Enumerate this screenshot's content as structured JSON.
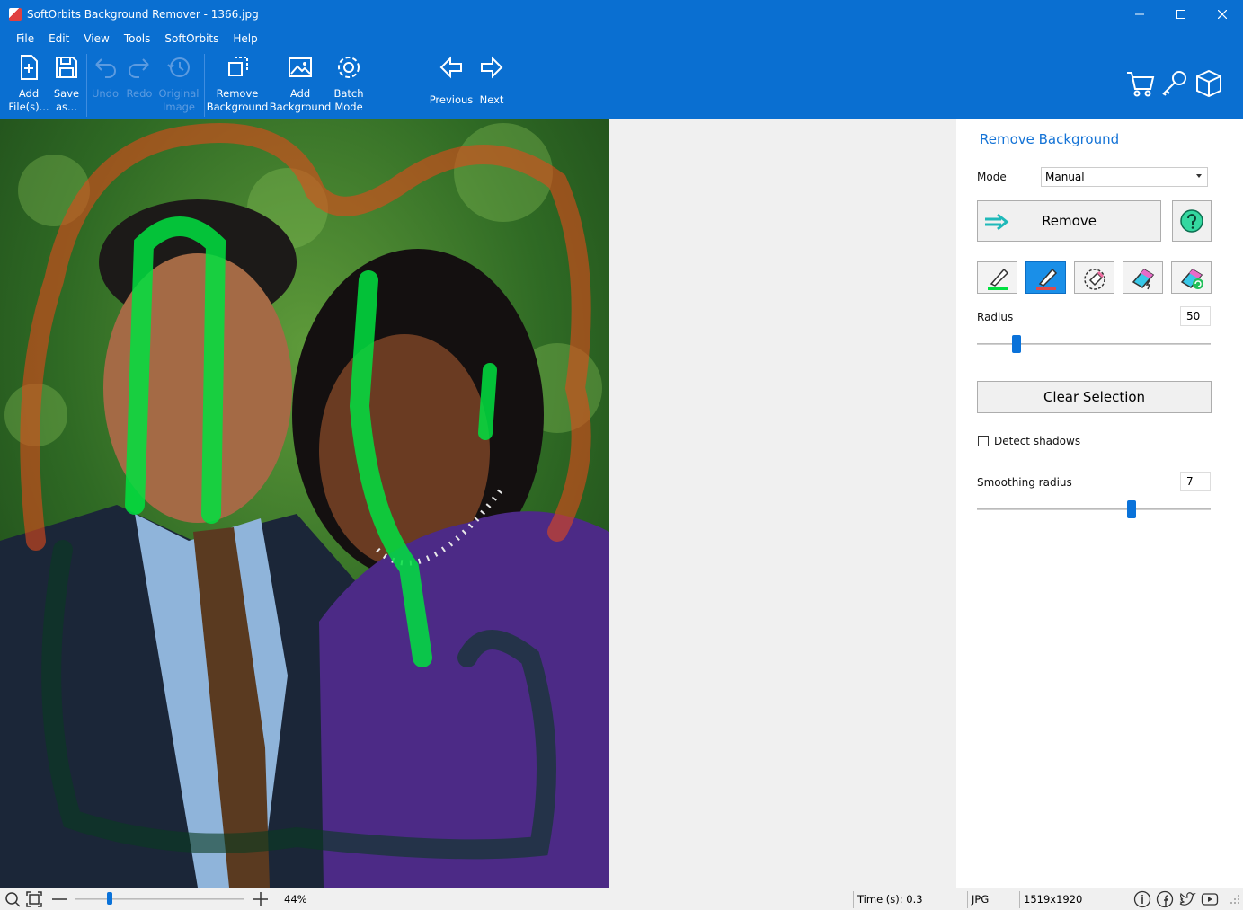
{
  "window": {
    "title": "SoftOrbits Background Remover - 1366.jpg",
    "minimize_icon": "minimize-icon",
    "maximize_icon": "maximize-icon",
    "close_icon": "close-icon"
  },
  "menu": [
    "File",
    "Edit",
    "View",
    "Tools",
    "SoftOrbits",
    "Help"
  ],
  "toolbar": {
    "add_files": [
      "Add",
      "File(s)..."
    ],
    "save_as": [
      "Save",
      "as..."
    ],
    "undo": "Undo",
    "redo": "Redo",
    "original_image": [
      "Original",
      "Image"
    ],
    "remove_background": [
      "Remove",
      "Background"
    ],
    "add_background": [
      "Add",
      "Background"
    ],
    "batch_mode": [
      "Batch",
      "Mode"
    ],
    "previous": "Previous",
    "next": "Next"
  },
  "panel": {
    "title": "Remove Background",
    "mode_label": "Mode",
    "mode_value": "Manual",
    "remove_button": "Remove",
    "radius_label": "Radius",
    "radius_value": "50",
    "radius_level": 0.17,
    "clear_selection": "Clear Selection",
    "detect_shadows": "Detect shadows",
    "detect_shadows_checked": false,
    "smoothing_label": "Smoothing radius",
    "smoothing_value": "7",
    "smoothing_level": 0.66
  },
  "status": {
    "zoom": "44%",
    "zoom_level": 0.2,
    "time": "Time (s): 0.3",
    "format": "JPG",
    "dimensions": "1519x1920"
  },
  "colors": {
    "accent": "#0a6fd1",
    "keep_brush": "#00e040",
    "remove_brush": "#e04a1a"
  }
}
